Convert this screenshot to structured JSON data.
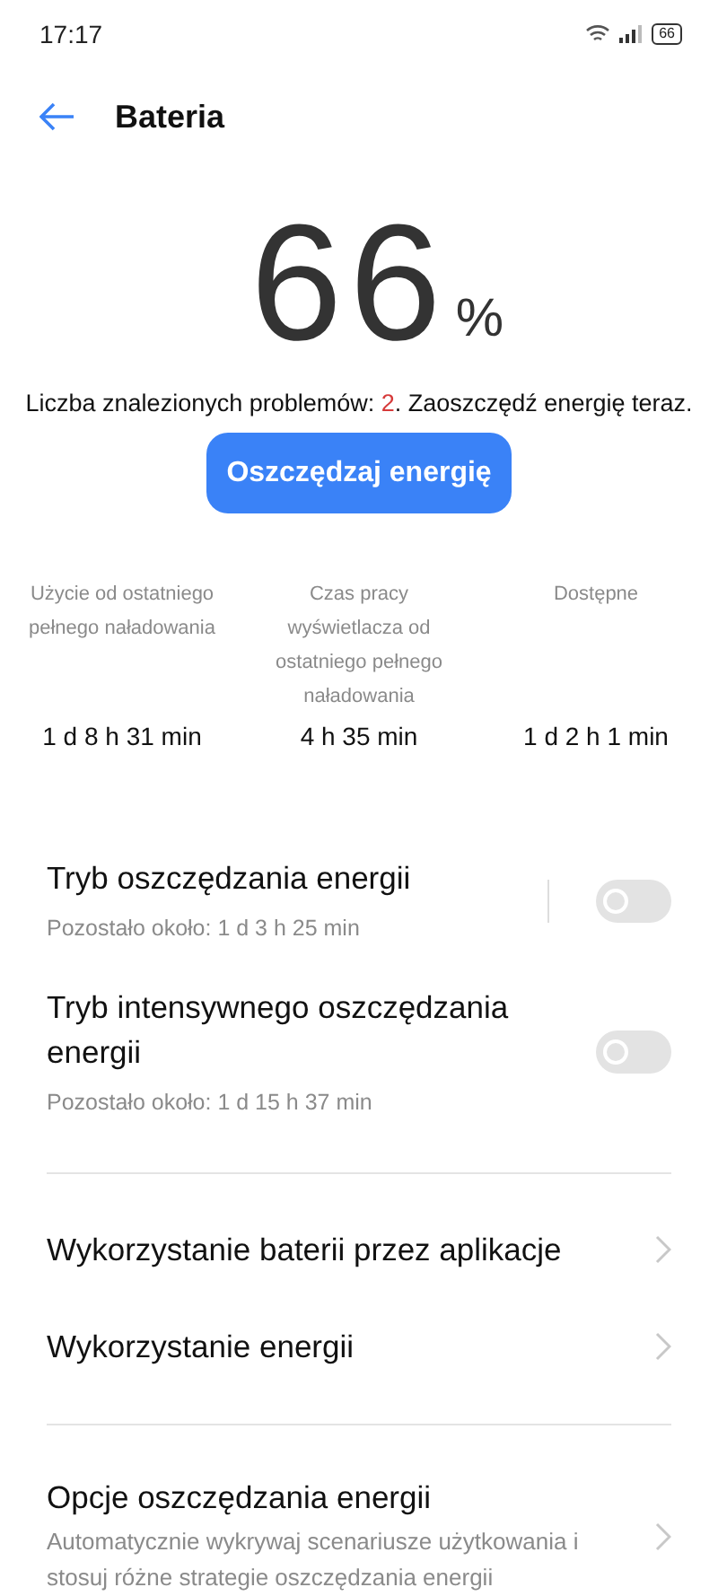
{
  "status_bar": {
    "time": "17:17",
    "battery": "66"
  },
  "header": {
    "title": "Bateria"
  },
  "level": {
    "value": "66",
    "unit": "%"
  },
  "problems": {
    "before": "Liczba znalezionych problemów: ",
    "count": "2",
    "after": ". Zaoszczędź energię teraz."
  },
  "action_button": "Oszczędzaj energię",
  "stats": [
    {
      "label": "Użycie od ostatniego pełnego naładowania",
      "value": "1 d 8 h 31 min"
    },
    {
      "label": "Czas pracy wyświetlacza od ostatniego pełnego naładowania",
      "value": "4 h 35 min"
    },
    {
      "label": "Dostępne",
      "value": "1 d 2 h 1 min"
    }
  ],
  "modes": [
    {
      "title": "Tryb oszczędzania energii",
      "subtitle": "Pozostało około:  1 d 3 h 25 min",
      "on": false,
      "divider": true
    },
    {
      "title": "Tryb intensywnego oszczędzania energii",
      "subtitle": "Pozostało około:  1 d 15 h 37 min",
      "on": false,
      "divider": false
    }
  ],
  "links": [
    {
      "title": "Wykorzystanie baterii przez aplikacje"
    },
    {
      "title": "Wykorzystanie energii"
    }
  ],
  "options": [
    {
      "title": "Opcje oszczędzania energii",
      "subtitle": "Automatycznie wykrywaj scenariusze użytkowania i stosuj różne strategie oszczędzania energii"
    }
  ]
}
